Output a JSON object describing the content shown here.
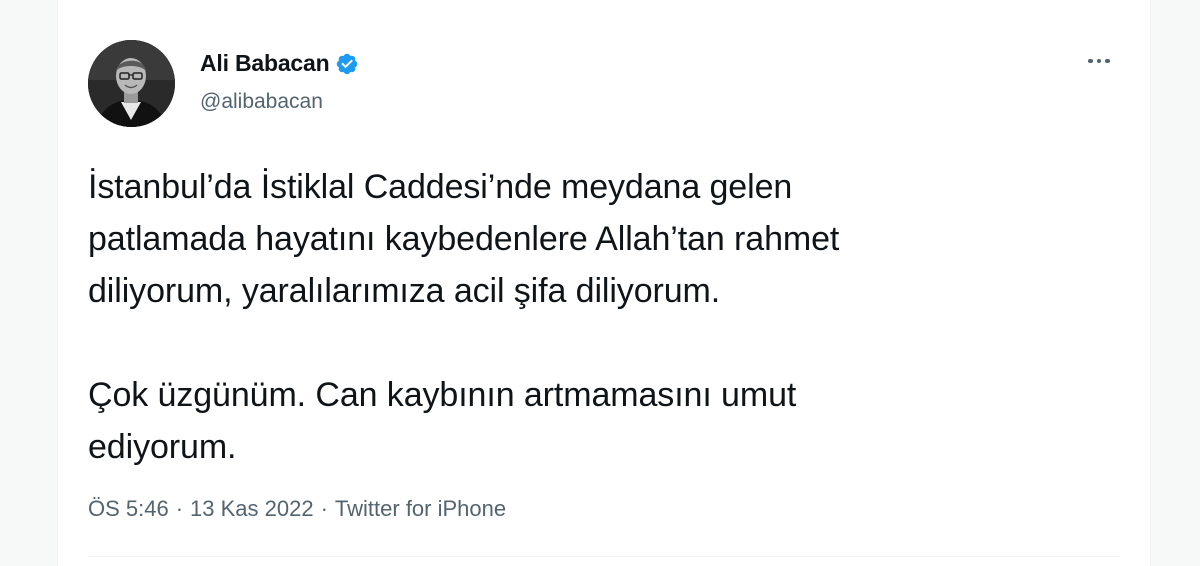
{
  "tweet": {
    "author": {
      "display_name": "Ali Babacan",
      "handle": "@alibabacan",
      "verified": true,
      "avatar_icon": "profile-photo"
    },
    "text": "İstanbul’da İstiklal Caddesi’nde meydana gelen\npatlamada hayatını kaybedenlere Allah’tan rahmet\ndiliyorum, yaralılarımıza acil şifa diliyorum.\n\nÇok üzgünüm. Can kaybının artmamasını umut\nediyorum.",
    "time": "ÖS 5:46",
    "separator": "·",
    "date": "13 Kas 2022",
    "source": "Twitter for iPhone",
    "more_icon": "more-horizontal-icon"
  },
  "colors": {
    "verified_badge": "#1d9bf0",
    "text_primary": "#0f1419",
    "text_secondary": "#536471"
  }
}
